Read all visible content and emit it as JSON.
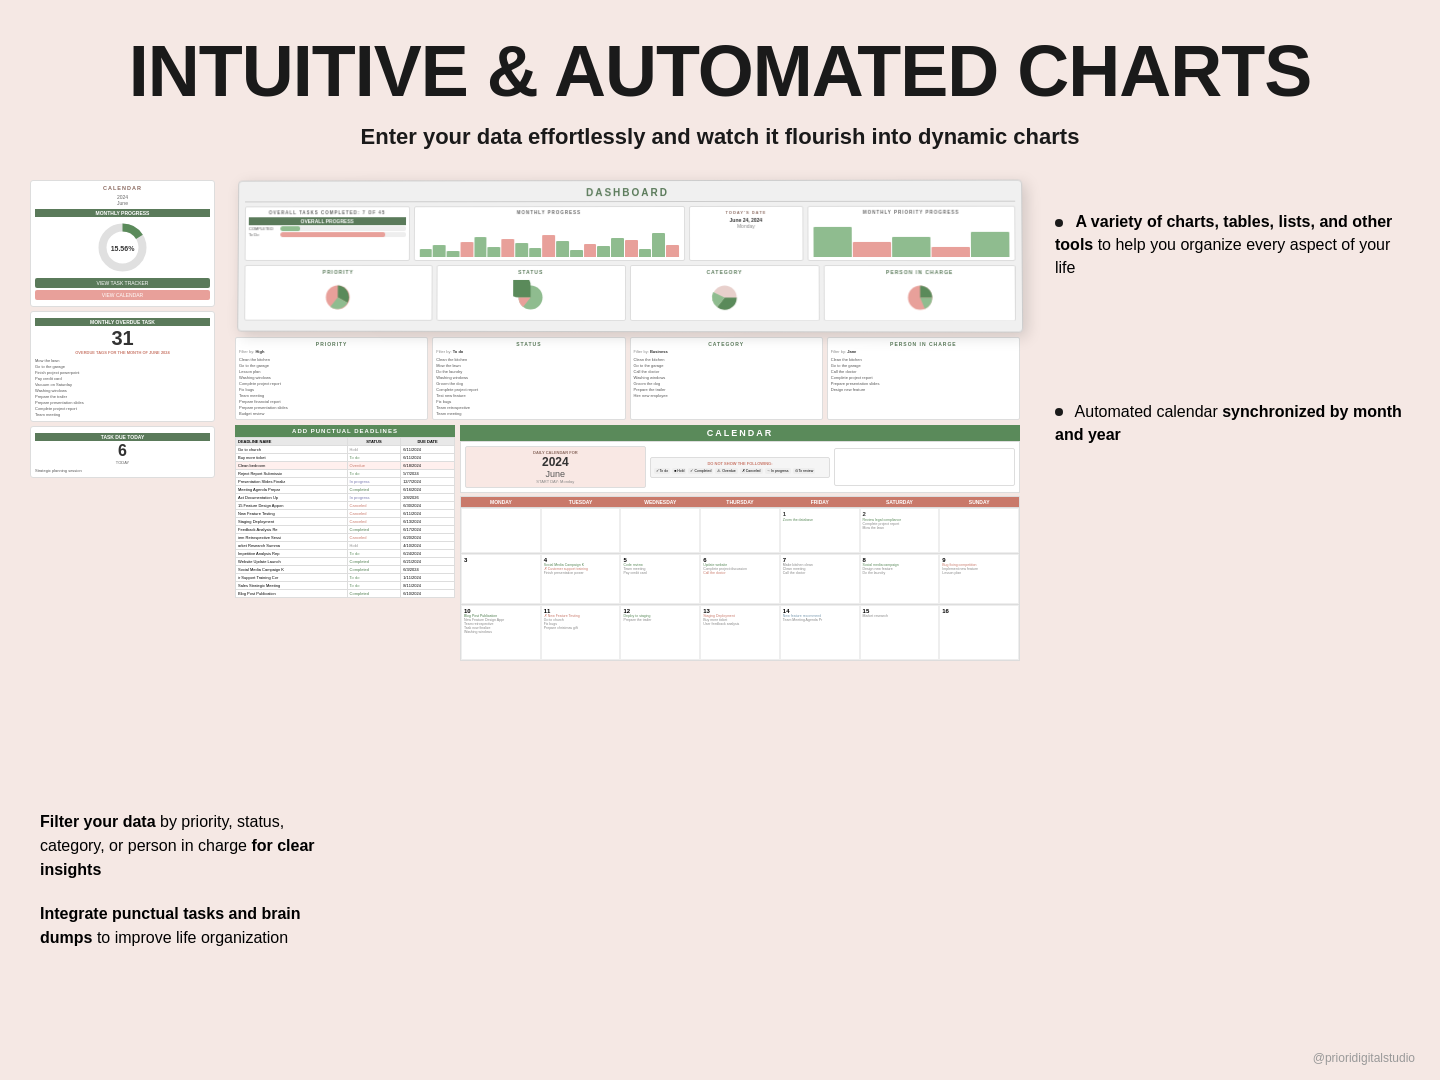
{
  "page": {
    "title": "INTUITIVE & AUTOMATED CHARTS",
    "subtitle": "Enter your data effortlessly and watch it flourish into dynamic charts",
    "footer_credit": "@prioridigitalstudio"
  },
  "annotations": {
    "top_right_1": {
      "bullet": "•",
      "text_bold": "A variety of charts, tables, lists, and other tools",
      "text_normal": " to help you organize every aspect of your life"
    },
    "top_right_2": {
      "text_normal": "Automated calendar ",
      "text_bold": "synchronized by month and year"
    },
    "bottom_left_1": {
      "text_bold": "Filter your data",
      "text_normal": " by priority, status, category, or person in charge ",
      "text_bold2": "for clear insights"
    },
    "bottom_left_2": {
      "text_bold": "Integrate punctual tasks and brain dumps",
      "text_normal": " to improve life organization"
    }
  },
  "calendar_panel": {
    "title": "CALENDAR",
    "year": "2024",
    "month": "June",
    "monthly_progress_title": "MONTHLY PROGRESS",
    "donut_value": "15.56%",
    "view_task_label": "VIEW TASK TRACKER",
    "view_cal_label": "VIEW CALENDAR",
    "monthly_overdue_title": "MONTHLY OVERDUE TASK",
    "overdue_count": "31",
    "overdue_subtitle": "OVERDUE TAGS FOR THE MONTH OF JUNE 2024",
    "task_due_title": "TASK DUE TODAY",
    "task_due_count": "6",
    "task_due_label": "TODAY",
    "task_name": "Strategic planning session"
  },
  "dashboard": {
    "title": "DASHBOARD",
    "overall_tasks": "OVERALL TASKS COMPLETED: 7 OF 45",
    "monthly_progress_title": "MONTHLY PROGRESS",
    "monthly_priority_title": "MONTHLY PRIORITY PROGRESS",
    "overall_progress_title": "OVERALL PROGRESS",
    "priority_title": "PRIORITY",
    "status_title": "STATUS",
    "category_title": "CATEGORY",
    "person_title": "PERSON IN CHARGE",
    "today_date": "June 24, 2024",
    "today_day": "Monday"
  },
  "calendar_main": {
    "title": "CALENDAR",
    "daily_calendar_for": "DAILY CALENDAR FOR",
    "year": "2024",
    "month": "June",
    "start_day_label": "START DAY",
    "start_day_value": "Monday",
    "do_not_show": "DO NOT SHOW THE FOLLOWING:",
    "days": [
      "MONDAY",
      "TUESDAY",
      "WEDNESDAY",
      "THURSDAY",
      "FRIDAY",
      "SATURDAY",
      "SUNDAY"
    ],
    "weeks": [
      {
        "cells": [
          {
            "num": "",
            "events": []
          },
          {
            "num": "",
            "events": []
          },
          {
            "num": "",
            "events": []
          },
          {
            "num": "",
            "events": []
          },
          {
            "num": "1",
            "events": [
              "Zoom the database"
            ]
          },
          {
            "num": "2",
            "events": [
              "Review legal compliance",
              "Complete project report",
              "Mow the lawn"
            ]
          }
        ]
      },
      {
        "cells": [
          {
            "num": "3",
            "events": []
          },
          {
            "num": "4",
            "events": [
              "Social Media Campaign K",
              "Customer support training",
              "Finish presentation power"
            ]
          },
          {
            "num": "5",
            "events": [
              "Code review",
              "Team meeting",
              "Pay credit card"
            ]
          },
          {
            "num": "6",
            "events": [
              "Update website",
              "Complete project discussion",
              "Pay credit card"
            ]
          },
          {
            "num": "7",
            "events": [
              "Make kitchen clean",
              "Clean meeting",
              "Call the doctor"
            ]
          },
          {
            "num": "8",
            "events": [
              "Social media campaign",
              "Design new feature",
              "Do the laundry"
            ]
          },
          {
            "num": "9",
            "events": [
              "Bug fixing competition",
              "Implement new feature",
              "Lesson plan"
            ]
          }
        ]
      },
      {
        "cells": [
          {
            "num": "10",
            "events": [
              "Blog Post Publication",
              "New Feature Design Appr",
              "Team retrospective",
              "Task now finalize",
              "Washing windows"
            ]
          },
          {
            "num": "11",
            "events": [
              "New Feature Testing",
              "Go to church",
              "Fix bugs",
              "Prepare christmas gift"
            ]
          },
          {
            "num": "12",
            "events": [
              "Deploy to staging",
              "Prepare the trailer"
            ]
          },
          {
            "num": "13",
            "events": [
              "Staging Deployment",
              "Buy more ticket",
              "User feedback analysis"
            ]
          },
          {
            "num": "14",
            "events": [
              "New feature recommend",
              "Team Meeting Agenda Pr"
            ]
          },
          {
            "num": "15",
            "events": [
              "Market research"
            ]
          },
          {
            "num": "16",
            "events": []
          }
        ]
      }
    ]
  },
  "task_list": {
    "title": "ADD PUNCTUAL DEADLINES",
    "headers": [
      "DEADLINE NAME",
      "STATUS",
      "DUE DATE"
    ],
    "items": [
      {
        "name": "Go to church",
        "status": "Hold",
        "date": "6/11/2024"
      },
      {
        "name": "Buy more ticket",
        "status": "To do",
        "date": "6/11/2024"
      },
      {
        "name": "Clean bedroom",
        "status": "Overdue",
        "date": "6/18/2024"
      },
      {
        "name": "Reject Report Submissio",
        "status": "To do",
        "date": "5/7/2024"
      },
      {
        "name": "Presentation Slides Finaliz",
        "status": "In progress",
        "date": "12/7/2024"
      },
      {
        "name": "Meeting Agenda Prepar",
        "status": "Completed",
        "date": "6/16/2024"
      },
      {
        "name": "Act Documentation Up",
        "status": "In progress",
        "date": "2/8/2026"
      },
      {
        "name": "15 Feature Design Appon",
        "status": "Canceled",
        "date": "6/30/2024"
      },
      {
        "name": "New Feature Testing",
        "status": "Canceled",
        "date": "6/11/2024"
      },
      {
        "name": "Staging Deployment",
        "status": "Canceled",
        "date": "6/13/2024"
      },
      {
        "name": "Feedback Analysis Re",
        "status": "Completed",
        "date": "6/17/2024"
      },
      {
        "name": "iem Retrospective Sessi",
        "status": "Canceled",
        "date": "6/20/2024"
      },
      {
        "name": "arket Research Summa",
        "status": "Hold",
        "date": "4/10/2024"
      },
      {
        "name": "Impetitive Analysis Rep",
        "status": "To do",
        "date": "6/24/2024"
      },
      {
        "name": "Website Update Launch",
        "status": "Completed",
        "date": "6/21/2024"
      },
      {
        "name": "Social Media Campaign K",
        "status": "Completed",
        "date": "6/3/2024"
      },
      {
        "name": "ir Support Training Cor",
        "status": "To do",
        "date": "1/11/2024"
      },
      {
        "name": "Sales Strategic Meeting",
        "status": "To do",
        "date": "8/11/2024"
      },
      {
        "name": "Blog Post Publication",
        "status": "Completed",
        "date": "6/10/2024"
      }
    ]
  },
  "filter_panels": {
    "priority": {
      "title": "PRIORITY",
      "filter_label": "Filter by:",
      "filter_value": "High",
      "items": [
        "Clean the kitchen",
        "Go to the garage",
        "Lesson plan",
        "Washing windows",
        "Complete project report",
        "Fix bugs",
        "Team meeting",
        "Prepare financial report",
        "Prepare presentation slides",
        "Budget review"
      ]
    },
    "status": {
      "title": "STATUS",
      "filter_label": "Filter by:",
      "filter_value": "To do",
      "items": [
        "Clean the kitchen",
        "Mow the lawn",
        "Do the laundry",
        "Washing windows",
        "Groom the dog",
        "Complete project repor",
        "Test new feature",
        "Fix bugs",
        "Team retrospective",
        "Team meeting"
      ]
    },
    "category": {
      "title": "CATEGORY",
      "filter_label": "Filter by:",
      "filter_value": "Business",
      "items": [
        "Clean the kitchen",
        "Go to the garage",
        "Call the doctor",
        "Washing windows",
        "Groom the dog",
        "Prepare the trailer",
        "Hire new employee"
      ]
    },
    "person": {
      "title": "PERSON IN CHARGE",
      "filter_label": "Filter by:",
      "filter_value": "Jane",
      "items": [
        "Clean the kitchen",
        "Go to the garage",
        "Call the doctor",
        "Complete project report",
        "Prepare presentation slides",
        "Design new feature"
      ]
    }
  },
  "status_colors": {
    "green": "#5a8a5a",
    "pink": "#c9796a",
    "light_green": "#8fbc8f",
    "light_pink": "#e8a09a",
    "bg_pink": "#f5e8e4",
    "dark": "#1a1a1a"
  }
}
